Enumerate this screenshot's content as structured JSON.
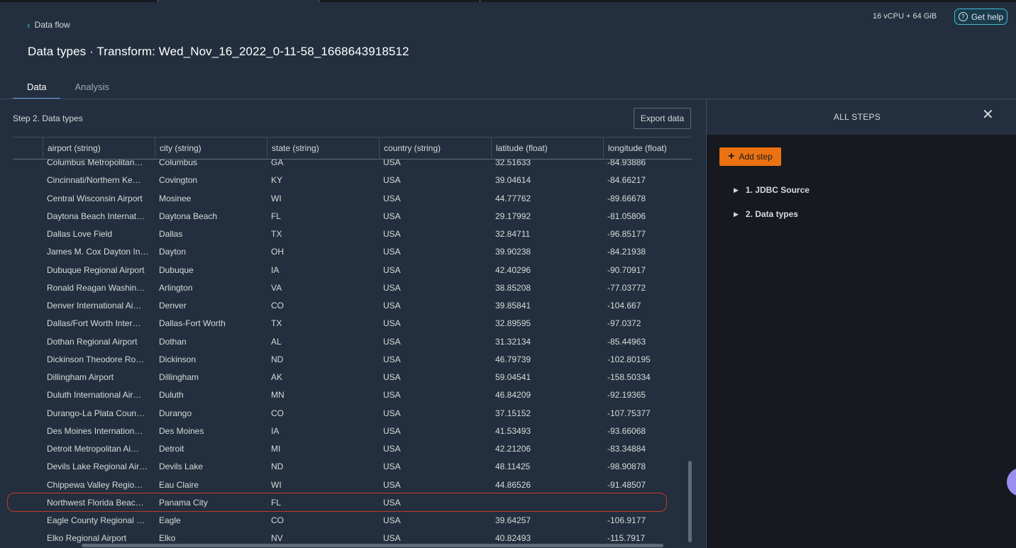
{
  "header": {
    "back_label": "Data flow",
    "title": "Data types · Transform: Wed_Nov_16_2022_0-11-58_1668643918512",
    "resources": "16 vCPU + 64 GiB",
    "help_label": "Get help"
  },
  "tabs": [
    {
      "label": "Data",
      "active": true
    },
    {
      "label": "Analysis",
      "active": false
    }
  ],
  "main": {
    "step_title": "Step 2. Data types",
    "export_label": "Export data",
    "columns": [
      "airport (string)",
      "city (string)",
      "state (string)",
      "country (string)",
      "latitude (float)",
      "longitude (float)"
    ],
    "rows": [
      [
        "Columbus Metropolitan…",
        "Columbus",
        "GA",
        "USA",
        "32.51633",
        "-84.93886"
      ],
      [
        "Cincinnati/Northern Ke…",
        "Covington",
        "KY",
        "USA",
        "39.04614",
        "-84.66217"
      ],
      [
        "Central Wisconsin Airport",
        "Mosinee",
        "WI",
        "USA",
        "44.77762",
        "-89.66678"
      ],
      [
        "Daytona Beach Internat…",
        "Daytona Beach",
        "FL",
        "USA",
        "29.17992",
        "-81.05806"
      ],
      [
        "Dallas Love Field",
        "Dallas",
        "TX",
        "USA",
        "32.84711",
        "-96.85177"
      ],
      [
        "James M. Cox Dayton In…",
        "Dayton",
        "OH",
        "USA",
        "39.90238",
        "-84.21938"
      ],
      [
        "Dubuque Regional Airport",
        "Dubuque",
        "IA",
        "USA",
        "42.40296",
        "-90.70917"
      ],
      [
        "Ronald Reagan Washin…",
        "Arlington",
        "VA",
        "USA",
        "38.85208",
        "-77.03772"
      ],
      [
        "Denver International Ai…",
        "Denver",
        "CO",
        "USA",
        "39.85841",
        "-104.667"
      ],
      [
        "Dallas/Fort Worth Inter…",
        "Dallas-Fort Worth",
        "TX",
        "USA",
        "32.89595",
        "-97.0372"
      ],
      [
        "Dothan Regional Airport",
        "Dothan",
        "AL",
        "USA",
        "31.32134",
        "-85.44963"
      ],
      [
        "Dickinson Theodore Ro…",
        "Dickinson",
        "ND",
        "USA",
        "46.79739",
        "-102.80195"
      ],
      [
        "Dillingham Airport",
        "Dillingham",
        "AK",
        "USA",
        "59.04541",
        "-158.50334"
      ],
      [
        "Duluth International Air…",
        "Duluth",
        "MN",
        "USA",
        "46.84209",
        "-92.19365"
      ],
      [
        "Durango-La Plata Coun…",
        "Durango",
        "CO",
        "USA",
        "37.15152",
        "-107.75377"
      ],
      [
        "Des Moines Internation…",
        "Des Moines",
        "IA",
        "USA",
        "41.53493",
        "-93.66068"
      ],
      [
        "Detroit Metropolitan Ai…",
        "Detroit",
        "MI",
        "USA",
        "42.21206",
        "-83.34884"
      ],
      [
        "Devils Lake Regional Air…",
        "Devils Lake",
        "ND",
        "USA",
        "48.11425",
        "-98.90878"
      ],
      [
        "Chippewa Valley Regio…",
        "Eau Claire",
        "WI",
        "USA",
        "44.86526",
        "-91.48507"
      ],
      [
        "Northwest Florida Beac…",
        "Panama City",
        "FL",
        "USA",
        "",
        ""
      ],
      [
        "Eagle County Regional …",
        "Eagle",
        "CO",
        "USA",
        "39.64257",
        "-106.9177"
      ],
      [
        "Elko Regional Airport",
        "Elko",
        "NV",
        "USA",
        "40.82493",
        "-115.7917"
      ]
    ]
  },
  "steps_panel": {
    "title": "ALL STEPS",
    "add_label": "Add step",
    "steps": [
      "1. JDBC Source",
      "2. Data types"
    ]
  }
}
